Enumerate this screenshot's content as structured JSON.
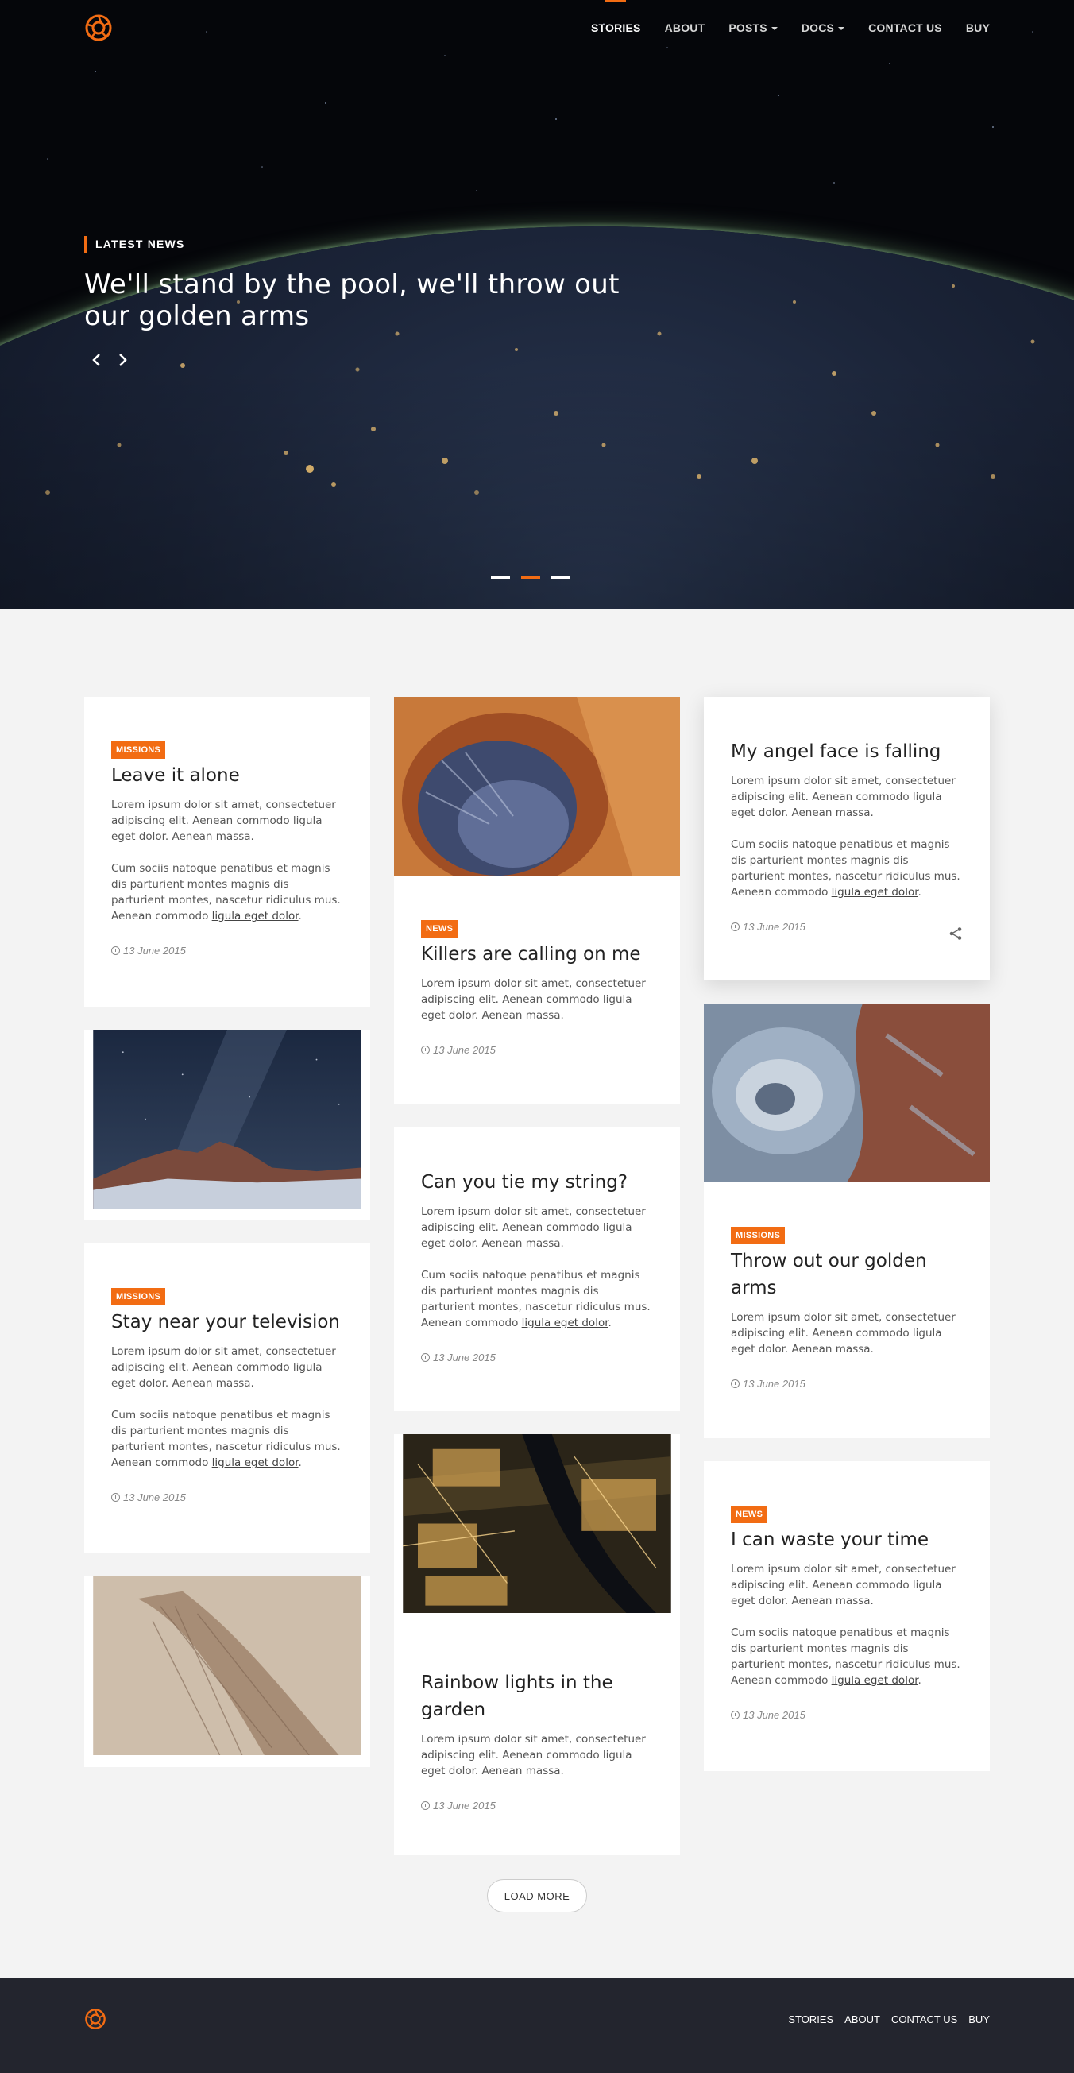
{
  "nav": {
    "items": [
      {
        "label": "STORIES",
        "active": true
      },
      {
        "label": "ABOUT"
      },
      {
        "label": "POSTS",
        "dropdown": true
      },
      {
        "label": "DOCS",
        "dropdown": true
      },
      {
        "label": "CONTACT US"
      },
      {
        "label": "BUY"
      }
    ]
  },
  "hero": {
    "kicker": "LATEST NEWS",
    "title": "We'll stand by the pool, we'll throw out our golden arms",
    "slides": 3,
    "active_slide": 2
  },
  "colors": {
    "accent": "#f26c13",
    "footer_bg": "#23252e",
    "page_bg": "#f3f3f3"
  },
  "cards": [
    {
      "badge": "MISSIONS",
      "title": "Leave it alone",
      "p1": "Lorem ipsum dolor sit amet, consectetuer adipiscing elit. Aenean commodo ligula eget dolor. Aenean massa.",
      "p2": "Cum sociis natoque penatibus et magnis dis parturient montes magnis dis parturient montes, nascetur ridiculus mus. Aenean commodo ",
      "link": "ligula eget dolor",
      "date": "13 June 2015"
    },
    {
      "badge": "NEWS",
      "title": "Killers are calling on me",
      "p1": "Lorem ipsum dolor sit amet, consectetuer adipiscing elit. Aenean commodo ligula eget dolor. Aenean massa.",
      "date": "13 June 2015",
      "image": "mars-crater-photo"
    },
    {
      "title": "My angel face is falling",
      "p1": "Lorem ipsum dolor sit amet, consectetuer adipiscing elit. Aenean commodo ligula eget dolor. Aenean massa.",
      "p2": "Cum sociis natoque penatibus et magnis dis parturient montes magnis dis parturient montes, nascetur ridiculus mus. Aenean commodo ",
      "link": "ligula eget dolor",
      "date": "13 June 2015"
    },
    {
      "image": "milky-way-mountain-photo"
    },
    {
      "badge": "MISSIONS",
      "title": "Stay near your television",
      "p1": "Lorem ipsum dolor sit amet, consectetuer adipiscing elit. Aenean commodo ligula eget dolor. Aenean massa.",
      "p2": "Cum sociis natoque penatibus et magnis dis parturient montes magnis dis parturient montes, nascetur ridiculus mus. Aenean commodo ",
      "link": "ligula eget dolor",
      "date": "13 June 2015"
    },
    {
      "image": "desert-aerial-photo"
    },
    {
      "title": "Can you tie my string?",
      "p1": "Lorem ipsum dolor sit amet, consectetuer adipiscing elit. Aenean commodo ligula eget dolor. Aenean massa.",
      "p2": "Cum sociis natoque penatibus et magnis dis parturient montes magnis dis parturient montes, nascetur ridiculus mus. Aenean commodo ",
      "link": "ligula eget dolor",
      "date": "13 June 2015"
    },
    {
      "title": "Rainbow lights in the garden",
      "p1": "Lorem ipsum dolor sit amet, consectetuer adipiscing elit. Aenean commodo ligula eget dolor. Aenean massa.",
      "date": "13 June 2015",
      "image": "city-night-aerial-photo"
    },
    {
      "badge": "MISSIONS",
      "title": "Throw out our golden arms",
      "p1": "Lorem ipsum dolor sit amet, consectetuer adipiscing elit. Aenean commodo ligula eget dolor. Aenean massa.",
      "date": "13 June 2015",
      "image": "mars-terrain-photo"
    },
    {
      "badge": "NEWS",
      "title": "I can waste your time",
      "p1": "Lorem ipsum dolor sit amet, consectetuer adipiscing elit. Aenean commodo ligula eget dolor. Aenean massa.",
      "p2": "Cum sociis natoque penatibus et magnis dis parturient montes magnis dis parturient montes, nascetur ridiculus mus. Aenean commodo ",
      "link": "ligula eget dolor",
      "date": "13 June 2015"
    }
  ],
  "load_more": "LOAD MORE",
  "footer": {
    "items": [
      "STORIES",
      "ABOUT",
      "CONTACT US",
      "BUY"
    ]
  }
}
